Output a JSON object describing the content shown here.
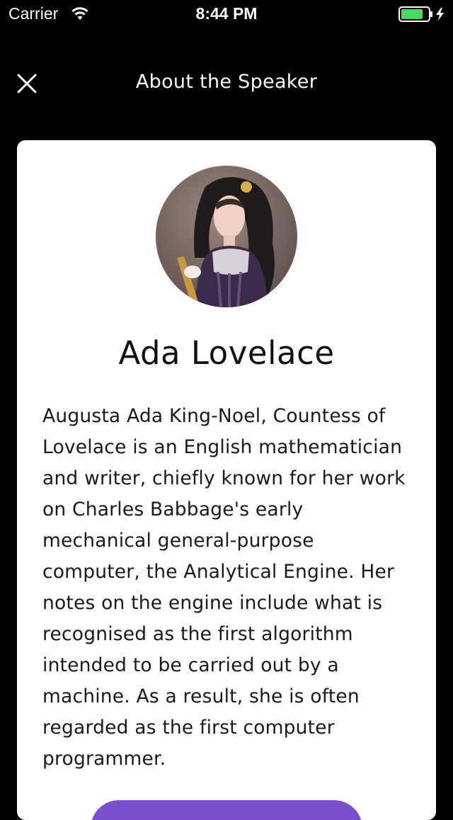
{
  "status_bar": {
    "carrier": "Carrier",
    "time": "8:44 PM",
    "battery_color": "#4cd964"
  },
  "nav": {
    "title": "About the Speaker",
    "close_icon": "close-icon"
  },
  "speaker": {
    "name": "Ada Lovelace",
    "bio": "Augusta Ada King-Noel, Countess of Lovelace is an English mathematician and writer, chiefly known for her work on Charles Babbage's early mechanical general-purpose computer, the Analytical Engine. Her notes on the engine include what is recognised as the first algorithm intended to be carried out by a machine. As a result, she is often regarded as the first computer programmer.",
    "photo": "speaker-portrait"
  },
  "colors": {
    "background": "#000000",
    "card": "#ffffff",
    "accent": "#7b4fd0"
  }
}
